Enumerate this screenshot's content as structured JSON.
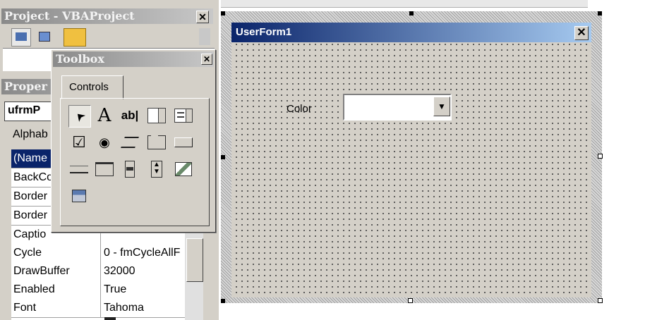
{
  "project_explorer": {
    "title": "Project - VBAProject"
  },
  "properties": {
    "title": "Proper",
    "object_selector": "ufrmP",
    "tab_alpha": "Alphab",
    "rows": [
      {
        "name": "(Name",
        "value": "",
        "selected": true
      },
      {
        "name": "BackCo",
        "value": ""
      },
      {
        "name": "Border",
        "value": ""
      },
      {
        "name": "Border",
        "value": ""
      },
      {
        "name": "Captio",
        "value": ""
      },
      {
        "name": "Cycle",
        "value": "0 - fmCycleAllF"
      },
      {
        "name": "DrawBuffer",
        "value": "32000"
      },
      {
        "name": "Enabled",
        "value": "True"
      },
      {
        "name": "Font",
        "value": "Tahoma"
      }
    ]
  },
  "toolbox": {
    "title": "Toolbox",
    "tab": "Controls",
    "tools": [
      {
        "icon": "select-objects-icon",
        "glyph": "➤"
      },
      {
        "icon": "label-icon",
        "glyph": "A"
      },
      {
        "icon": "textbox-icon",
        "glyph": "ab|"
      },
      {
        "icon": "combobox-icon",
        "glyph": ""
      },
      {
        "icon": "listbox-icon",
        "glyph": ""
      },
      {
        "icon": "checkbox-icon",
        "glyph": "☑"
      },
      {
        "icon": "option-button-icon",
        "glyph": "◉"
      },
      {
        "icon": "toggle-button-icon",
        "glyph": ""
      },
      {
        "icon": "frame-icon",
        "glyph": ""
      },
      {
        "icon": "command-button-icon",
        "glyph": ""
      },
      {
        "icon": "tabstrip-icon",
        "glyph": ""
      },
      {
        "icon": "multipage-icon",
        "glyph": ""
      },
      {
        "icon": "scrollbar-icon",
        "glyph": ""
      },
      {
        "icon": "spinbutton-icon",
        "glyph": ""
      },
      {
        "icon": "image-icon",
        "glyph": ""
      },
      {
        "icon": "refedit-icon",
        "glyph": ""
      }
    ]
  },
  "userform": {
    "title": "UserForm1",
    "close": "×",
    "label": "Color",
    "combobox_value": ""
  },
  "colors": {
    "form_title_start": "#0a246a",
    "form_title_end": "#a6caf0",
    "face": "#d4d0c8"
  }
}
